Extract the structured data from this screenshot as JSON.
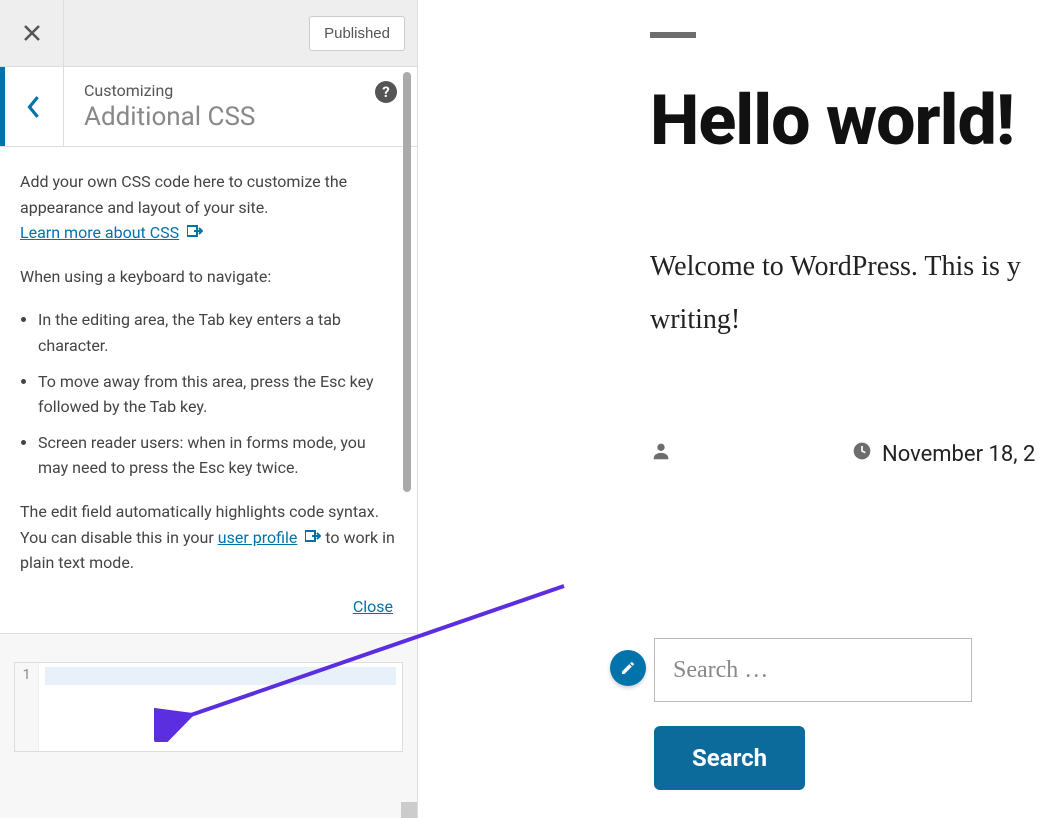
{
  "topbar": {
    "published_label": "Published"
  },
  "panel": {
    "sub": "Customizing",
    "title": "Additional CSS",
    "help_glyph": "?"
  },
  "desc": {
    "p1": "Add your own CSS code here to customize the appearance and layout of your site.",
    "learn_link": "Learn more about CSS",
    "p2": "When using a keyboard to navigate:",
    "li1": "In the editing area, the Tab key enters a tab character.",
    "li2": "To move away from this area, press the Esc key followed by the Tab key.",
    "li3": "Screen reader users: when in forms mode, you may need to press the Esc key twice.",
    "p3a": "The edit field automatically highlights code syntax. You can disable this in your ",
    "profile_link": "user profile",
    "p3b": " to work in plain text mode.",
    "close_link": "Close"
  },
  "editor": {
    "line_no": "1"
  },
  "preview": {
    "heading": "Hello world!",
    "body": "Welcome to WordPress. This is y",
    "body2": "writing!",
    "date": "November 18, 2",
    "search_placeholder": "Search …",
    "search_button": "Search"
  }
}
